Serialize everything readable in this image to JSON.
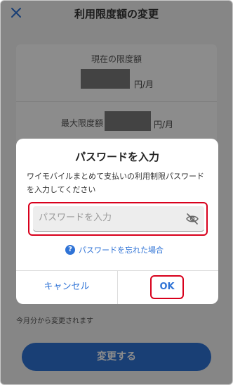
{
  "header": {
    "title": "利用限度額の変更"
  },
  "limits": {
    "current_label": "現在の限度額",
    "max_label": "最大限度額",
    "unit": "円/月"
  },
  "note": "今月分から変更されます",
  "submit_label": "変更する",
  "dialog": {
    "title": "パスワードを入力",
    "description": "ワイモバイルまとめて支払いの利用制限パスワードを入力してください",
    "password_placeholder": "パスワードを入力",
    "forgot_label": "パスワードを忘れた場合",
    "cancel_label": "キャンセル",
    "ok_label": "OK"
  },
  "colors": {
    "accent": "#2f73d6",
    "highlight": "#d8001c"
  }
}
